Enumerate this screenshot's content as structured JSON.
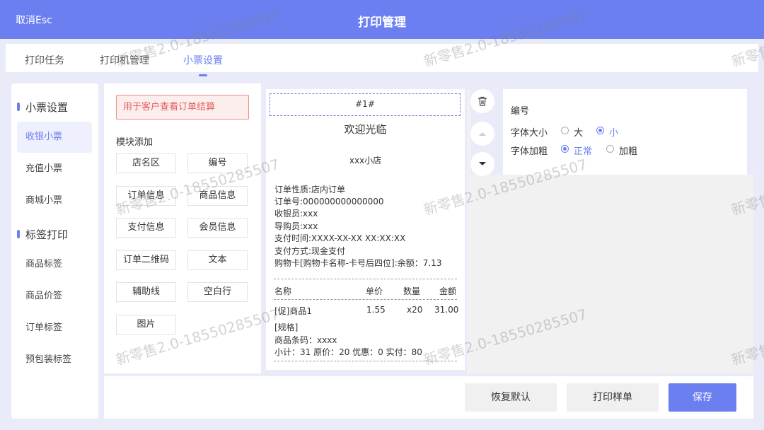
{
  "header": {
    "cancel_label": "取消Esc",
    "title": "打印管理"
  },
  "tabs": [
    {
      "label": "打印任务"
    },
    {
      "label": "打印机管理"
    },
    {
      "label": "小票设置"
    }
  ],
  "sidebar": {
    "group1": "小票设置",
    "group2": "标签打印",
    "items": [
      {
        "label": "收银小票"
      },
      {
        "label": "充值小票"
      },
      {
        "label": "商城小票"
      },
      {
        "label": "商品标签"
      },
      {
        "label": "商品价签"
      },
      {
        "label": "订单标签"
      },
      {
        "label": "预包装标签"
      }
    ]
  },
  "modules": {
    "hint": "用于客户查看订单结算",
    "title": "模块添加",
    "buttons": [
      "店名区",
      "编号",
      "订单信息",
      "商品信息",
      "支付信息",
      "会员信息",
      "订单二维码",
      "文本",
      "辅助线",
      "空白行",
      "图片"
    ]
  },
  "receipt": {
    "number": "#1#",
    "welcome": "欢迎光临",
    "shop": "xxx小店",
    "lines": [
      "订单性质:店内订单",
      "订单号:000000000000000",
      "收银员:xxx",
      "导购员:xxx",
      "支付时间:XXXX-XX-XX XX:XX:XX",
      "支付方式:现金支付",
      "购物卡[购物卡名称-卡号后四位]:余额：7.13"
    ],
    "cols": {
      "name": "名称",
      "price": "单价",
      "qty": "数量",
      "amount": "金额"
    },
    "item": {
      "name": "[促]商品1",
      "price": "1.55",
      "qty": "x20",
      "amount": "31.00"
    },
    "spec": "[规格]",
    "barcode": "商品条码：xxxx",
    "subtotal": "小计：31 原价：20 优惠：0 实付：80"
  },
  "props": {
    "title": "编号",
    "font_size_label": "字体大小",
    "font_size_options": [
      "大",
      "小"
    ],
    "font_size_selected": "小",
    "bold_label": "字体加粗",
    "bold_options": [
      "正常",
      "加粗"
    ],
    "bold_selected": "正常"
  },
  "footer": {
    "reset": "恢复默认",
    "print_sample": "打印样单",
    "save": "保存"
  },
  "watermark": "新零售2.0-18550285507",
  "colors": {
    "accent": "#6b7ff0",
    "hint_red": "#e35c5c"
  }
}
